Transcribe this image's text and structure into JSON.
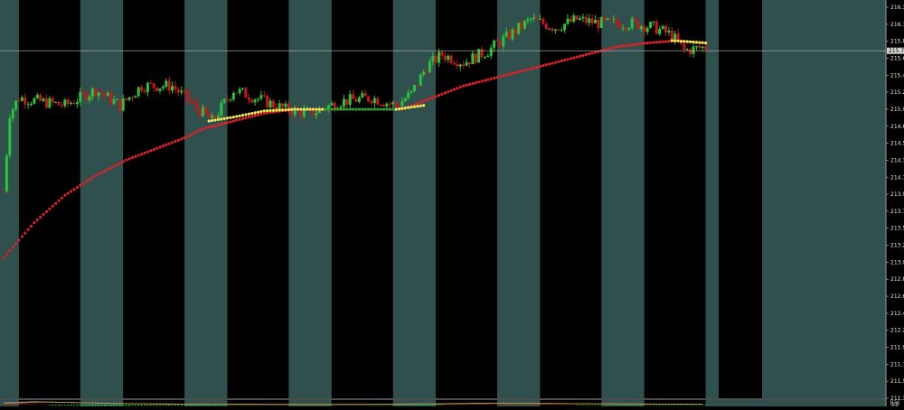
{
  "chart_data": [
    {
      "type": "candlestick",
      "panel": "main",
      "title": "",
      "y_ticks": [
        "216.3",
        "216.1",
        "215.8",
        "215.6",
        "215.4",
        "215.2",
        "215.0",
        "214.8",
        "214.5",
        "214.3",
        "214.1",
        "213.9",
        "213.7",
        "213.5",
        "213.2",
        "213.0",
        "212.8",
        "212.6",
        "212.4",
        "212.2",
        "211.9",
        "211.7",
        "211.5",
        "211.3"
      ],
      "ylim": [
        211.3,
        216.4
      ],
      "current_price_label": "215.7",
      "current_price": 215.75,
      "num_bars": 230,
      "session_band_pattern": [
        "light",
        "dark",
        "light",
        "dark",
        "light",
        "dark",
        "light",
        "dark",
        "light",
        "dark",
        "light",
        "dark",
        "light",
        "dark"
      ],
      "session_band_edges_bars": [
        0,
        5,
        25,
        39,
        59,
        73,
        93,
        107,
        127,
        141,
        161,
        175,
        195,
        209,
        229
      ],
      "candle_anchors": [
        [
          0,
          213.95
        ],
        [
          2,
          214.95
        ],
        [
          5,
          215.15
        ],
        [
          12,
          215.1
        ],
        [
          20,
          215.05
        ],
        [
          30,
          215.25
        ],
        [
          38,
          215.05
        ],
        [
          45,
          215.3
        ],
        [
          55,
          215.3
        ],
        [
          62,
          215.05
        ],
        [
          68,
          214.85
        ],
        [
          75,
          215.25
        ],
        [
          82,
          215.15
        ],
        [
          92,
          215.0
        ],
        [
          100,
          214.95
        ],
        [
          110,
          215.1
        ],
        [
          120,
          215.15
        ],
        [
          128,
          215.05
        ],
        [
          133,
          215.2
        ],
        [
          138,
          215.55
        ],
        [
          143,
          215.7
        ],
        [
          150,
          215.6
        ],
        [
          158,
          215.75
        ],
        [
          165,
          215.95
        ],
        [
          172,
          216.15
        ],
        [
          180,
          216.05
        ],
        [
          187,
          216.15
        ],
        [
          195,
          216.1
        ],
        [
          205,
          216.1
        ],
        [
          212,
          216.05
        ],
        [
          218,
          215.95
        ],
        [
          222,
          215.75
        ],
        [
          229,
          215.8
        ]
      ],
      "colors": {
        "bull": "#27c43a",
        "bear": "#c8161d",
        "band_light": "#2f504d",
        "band_dark": "#000000",
        "price_line": "#b8b8b8",
        "dots_red": "#d8222a",
        "dots_yellow": "#f0e65a",
        "dots_green": "#2aa23a"
      },
      "overlays": [
        {
          "kind": "dots",
          "color": "red",
          "points": [
            [
              0,
              213.1
            ],
            [
              10,
              213.55
            ],
            [
              20,
              213.9
            ],
            [
              30,
              214.15
            ],
            [
              40,
              214.35
            ],
            [
              50,
              214.5
            ],
            [
              60,
              214.65
            ],
            [
              65,
              214.75
            ],
            [
              75,
              214.85
            ],
            [
              85,
              214.95
            ],
            [
              95,
              215.0
            ],
            [
              105,
              215.0
            ],
            [
              115,
              215.0
            ],
            [
              125,
              215.0
            ],
            [
              130,
              215.0
            ],
            [
              140,
              215.15
            ],
            [
              150,
              215.3
            ],
            [
              160,
              215.4
            ],
            [
              170,
              215.5
            ],
            [
              180,
              215.6
            ],
            [
              190,
              215.7
            ],
            [
              200,
              215.8
            ],
            [
              210,
              215.85
            ],
            [
              220,
              215.88
            ],
            [
              229,
              215.85
            ]
          ]
        },
        {
          "kind": "dots",
          "color": "yellow",
          "points": [
            [
              67,
              214.85
            ],
            [
              75,
              214.9
            ],
            [
              85,
              214.98
            ],
            [
              95,
              215.0
            ],
            [
              105,
              215.0
            ]
          ]
        },
        {
          "kind": "dots",
          "color": "green",
          "points": [
            [
              105,
              215.0
            ],
            [
              115,
              215.0
            ],
            [
              128,
              215.0
            ]
          ]
        },
        {
          "kind": "dots",
          "color": "yellow",
          "points": [
            [
              128,
              215.0
            ],
            [
              137,
              215.05
            ]
          ]
        },
        {
          "kind": "dots",
          "color": "yellow",
          "points": [
            [
              218,
              215.88
            ],
            [
              229,
              215.85
            ]
          ]
        }
      ]
    },
    {
      "type": "histogram",
      "panel": "oscillator",
      "y_ticks": [
        "0.57",
        "0.00",
        "-0.2"
      ],
      "ylim": [
        -0.25,
        0.62
      ],
      "series": [
        {
          "kind": "bars",
          "anchors": [
            [
              0,
              0.15
            ],
            [
              5,
              0.2
            ],
            [
              10,
              0.1
            ],
            [
              14,
              0.02
            ],
            [
              15,
              -0.12
            ],
            [
              30,
              -0.16
            ],
            [
              45,
              -0.14
            ],
            [
              60,
              -0.1
            ],
            [
              80,
              -0.06
            ],
            [
              100,
              -0.05
            ],
            [
              120,
              -0.04
            ],
            [
              135,
              -0.05
            ],
            [
              150,
              0.04
            ],
            [
              165,
              0.06
            ],
            [
              180,
              0.05
            ],
            [
              190,
              -0.03
            ],
            [
              210,
              -0.04
            ],
            [
              229,
              -0.08
            ]
          ]
        },
        {
          "kind": "line",
          "color": "#4a86e0",
          "anchors": [
            [
              0,
              0.25
            ],
            [
              10,
              0.42
            ],
            [
              20,
              0.3
            ],
            [
              35,
              0.15
            ],
            [
              60,
              0.06
            ],
            [
              90,
              0.02
            ],
            [
              120,
              0.03
            ],
            [
              140,
              0.12
            ],
            [
              155,
              0.2
            ],
            [
              175,
              0.16
            ],
            [
              200,
              0.1
            ],
            [
              229,
              0.04
            ]
          ]
        },
        {
          "kind": "line",
          "color": "#d2a21c",
          "anchors": [
            [
              0,
              0.18
            ],
            [
              12,
              0.36
            ],
            [
              25,
              0.26
            ],
            [
              40,
              0.14
            ],
            [
              65,
              0.05
            ],
            [
              95,
              0.02
            ],
            [
              125,
              0.02
            ],
            [
              145,
              0.1
            ],
            [
              160,
              0.17
            ],
            [
              180,
              0.14
            ],
            [
              205,
              0.09
            ],
            [
              229,
              0.04
            ]
          ]
        }
      ],
      "colors": {
        "bar_pos": "#c8161d",
        "bar_neg": "#2fd04a"
      }
    }
  ]
}
